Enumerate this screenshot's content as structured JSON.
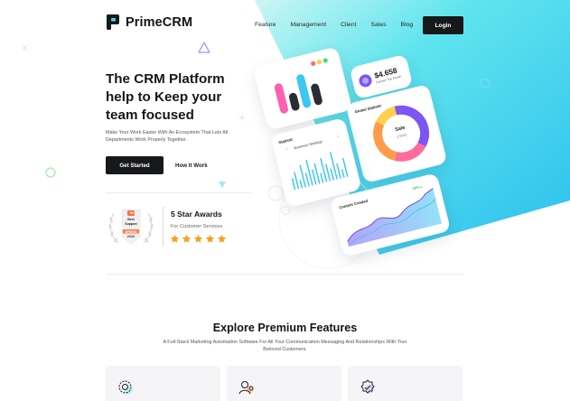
{
  "brand": {
    "name": "PrimeCRM"
  },
  "nav": {
    "items": [
      "Feature",
      "Management",
      "Client",
      "Sales",
      "Blog"
    ],
    "login": "Login"
  },
  "hero": {
    "title_lines": [
      "The CRM Platform",
      "help to Keep your",
      "team focused"
    ],
    "subtitle": "Make Your Work Easier With An Ecosystem That Lets All Departments Work Properly Together.",
    "primary_cta": "Get Started",
    "secondary_cta": "How It Work"
  },
  "award": {
    "badge_top": "G2",
    "badge_line1": "Best",
    "badge_line2": "Support",
    "badge_season": "SPRING",
    "badge_year": "202X",
    "title": "5 Star Awards",
    "subtitle": "For Customer Services",
    "stars": 5,
    "star_color": "#f4a21f"
  },
  "dashboard": {
    "amount": "$4.658",
    "amount_label": "Earned This Month",
    "global_label": "Global Statistic",
    "sale_label": "Sale",
    "sale_value": "(75%)",
    "statistic_label": "Statistic",
    "strategy_label": "Business Strategy",
    "content_label": "Content Created",
    "content_growth": "18% ▴"
  },
  "features": {
    "title": "Explore Premium Features",
    "subtitle": "A Full-Stack Marketing Automation Software For All Your Communication Messaging And Relationships With Your Beloved Customers."
  },
  "colors": {
    "accent_cyan": "#3dd6f0",
    "accent_purple": "#7d55f2",
    "accent_orange": "#ff9b4a",
    "dark": "#17181a"
  }
}
